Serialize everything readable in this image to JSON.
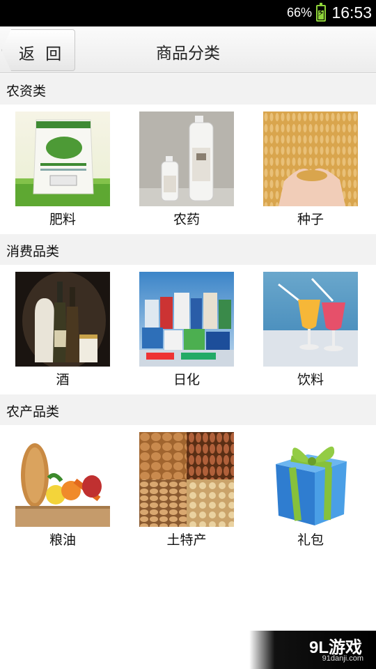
{
  "status_bar": {
    "battery_percent": "66%",
    "battery_level": 0.66,
    "time": "16:53"
  },
  "header": {
    "back_label": "返 回",
    "title": "商品分类"
  },
  "sections": [
    {
      "title": "农资类",
      "items": [
        {
          "label": "肥料",
          "image": "fertilizer-bag"
        },
        {
          "label": "农药",
          "image": "pesticide-bottles"
        },
        {
          "label": "种子",
          "image": "wheat-seeds"
        }
      ]
    },
    {
      "title": "消费品类",
      "items": [
        {
          "label": "酒",
          "image": "liquor-bottles"
        },
        {
          "label": "日化",
          "image": "household-products"
        },
        {
          "label": "饮料",
          "image": "juice-glasses"
        }
      ]
    },
    {
      "title": "农产品类",
      "items": [
        {
          "label": "粮油",
          "image": "grocery-bag"
        },
        {
          "label": "土特产",
          "image": "nuts"
        },
        {
          "label": "礼包",
          "image": "gift-box"
        }
      ]
    }
  ],
  "watermark": {
    "logo": "9L游戏",
    "url": "91danji.com"
  }
}
